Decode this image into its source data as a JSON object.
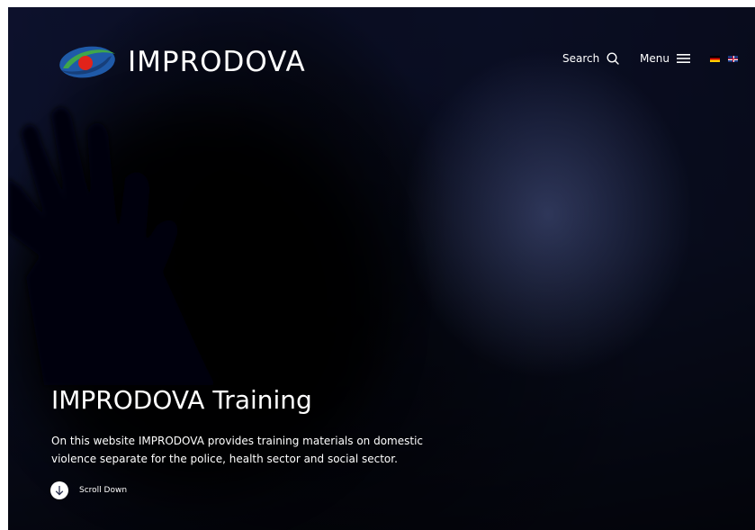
{
  "brand": {
    "name": "IMPRODOVA"
  },
  "nav": {
    "search_label": "Search",
    "menu_label": "Menu",
    "languages": [
      {
        "code": "de",
        "icon": "german-flag-icon"
      },
      {
        "code": "en",
        "icon": "uk-flag-icon"
      }
    ]
  },
  "hero": {
    "title": "IMPRODOVA Training",
    "description": "On this website IMPRODOVA provides training materials on domestic violence separate for the police, health sector and social sector.",
    "scroll_label": "Scroll Down"
  },
  "colors": {
    "logo_blue": "#1f5aa8",
    "logo_green": "#3fa64a",
    "logo_red": "#e2231a",
    "hero_blue": "#4b578d"
  }
}
